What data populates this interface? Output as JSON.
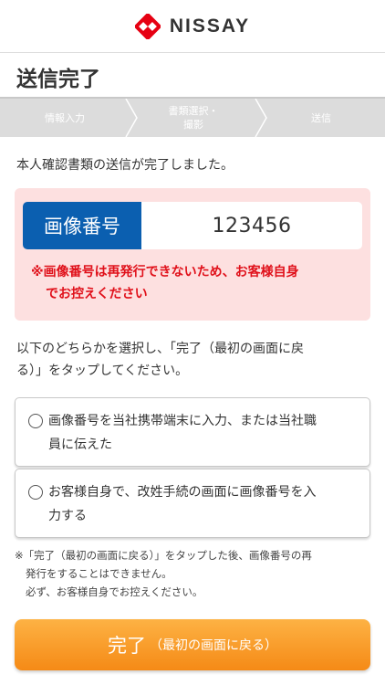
{
  "brand": {
    "name": "NISSAY",
    "logo_color": "#e60012"
  },
  "page": {
    "title": "送信完了"
  },
  "steps": [
    {
      "label": "情報入力"
    },
    {
      "label": "書類選択・",
      "label_line2": "撮影"
    },
    {
      "label": "送信"
    }
  ],
  "intro": "本人確認書類の送信が完了しました。",
  "image_number": {
    "label": "画像番号",
    "value": "123456",
    "warning_line1": "※画像番号は再発行できないため、お客様自身",
    "warning_line2": "でお控えください"
  },
  "instruction": {
    "line1": "以下のどちらかを選択し、「完了（最初の画面に戻",
    "line2": "る）」をタップしてください。"
  },
  "options": [
    {
      "line1": "画像番号を当社携帯端末に入力、または当社職",
      "line2": "員に伝えた"
    },
    {
      "line1": "お客様自身で、改姓手続の画面に画像番号を入",
      "line2": "力する"
    }
  ],
  "notes": {
    "line1": "※「完了（最初の画面に戻る）」をタップした後、画像番号の再",
    "line2": "発行をすることはできません。",
    "line3": "必ず、お客様自身でお控えください。"
  },
  "done_button": {
    "main": "完了",
    "sub": "（最初の画面に戻る）"
  },
  "colors": {
    "accent_blue": "#0b5fb0",
    "warning_red": "#e0101a",
    "pink_bg": "#fde0e0",
    "button_orange": "#f58a16"
  }
}
